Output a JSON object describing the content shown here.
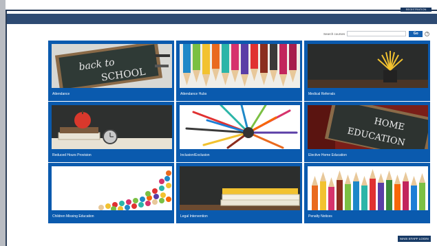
{
  "header": {
    "top_link": "REGISTRATION"
  },
  "search": {
    "label": "Search courses",
    "value": "",
    "go_label": "Go",
    "help_glyph": "?"
  },
  "courses": [
    {
      "label": "Attendance",
      "icon": "chalkboard-back-to-school"
    },
    {
      "label": "Attendance Hubs",
      "icon": "colored-pencils"
    },
    {
      "label": "Medical Referrals",
      "icon": "pencil-cup-chalkboard"
    },
    {
      "label": "Reduced Hours Provision",
      "icon": "apple-books-clock"
    },
    {
      "label": "Inclusion/Exclusion",
      "icon": "pencil-bundle"
    },
    {
      "label": "Elective Home Education",
      "icon": "home-education-chalkboard"
    },
    {
      "label": "Children Missing Education",
      "icon": "pencil-tips"
    },
    {
      "label": "Legal Intervention",
      "icon": "book-stack"
    },
    {
      "label": "Penalty Notices",
      "icon": "colored-pencils"
    }
  ],
  "footer": {
    "staff_login_label": "MAIS STAFF LOGIN"
  },
  "colors": {
    "header": "#2e4b73",
    "tile_blue": "#0a5aae",
    "go_button": "#1560b0"
  }
}
